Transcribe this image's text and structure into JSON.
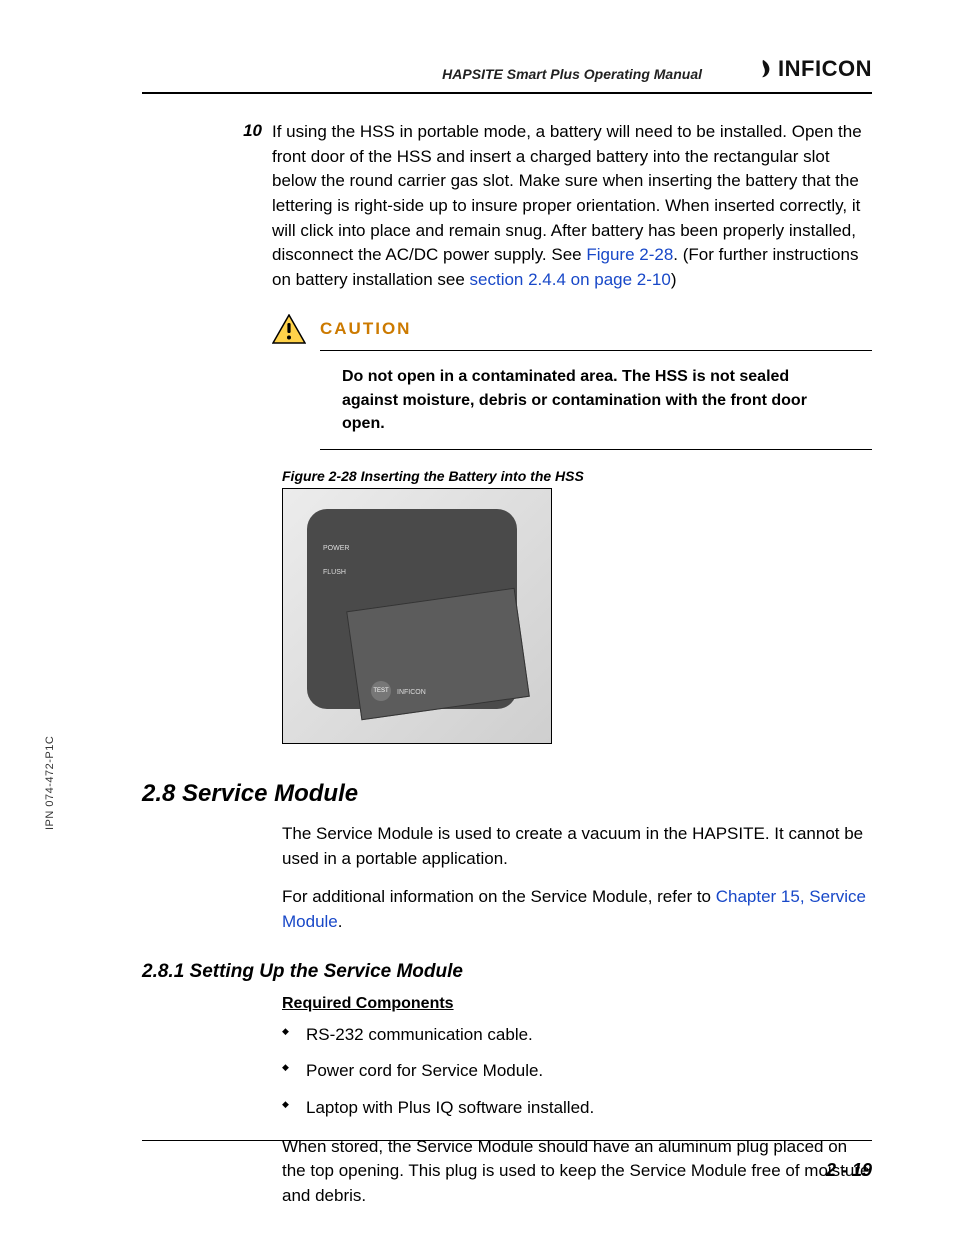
{
  "header": {
    "doc_title": "HAPSITE Smart Plus Operating Manual",
    "brand": "INFICON"
  },
  "step": {
    "number": "10",
    "text_pre": "If using the HSS in portable mode, a battery will need to be installed. Open the front door of the HSS and insert a charged battery into the rectangular slot below the round carrier gas slot. Make sure when inserting the battery that the lettering is right-side up to insure proper orientation. When inserted correctly, it will click into place and remain snug. After battery has been properly installed, disconnect the AC/DC power supply. See ",
    "link1": "Figure 2-28",
    "text_mid": ". (For further instructions on battery installation see ",
    "link2": "section 2.4.4 on page 2-10",
    "text_post": ")"
  },
  "caution": {
    "title": "CAUTION",
    "body": "Do not open in a contaminated area. The HSS is not sealed against moisture, debris or contamination with the front door open."
  },
  "figure": {
    "caption": "Figure 2-28  Inserting the Battery into the HSS",
    "label_power": "POWER",
    "label_flush": "FLUSH",
    "badge": "TEST",
    "brand_small": "INFICON"
  },
  "section28": {
    "heading": "2.8  Service Module",
    "p1": "The Service Module is used to create a vacuum in the HAPSITE. It cannot be used in a portable application.",
    "p2_pre": "For additional information on the Service Module, refer to ",
    "p2_link": "Chapter 15, Service Module",
    "p2_post": "."
  },
  "section281": {
    "heading": "2.8.1  Setting Up the Service Module",
    "subhead": "Required Components",
    "items": [
      "RS-232 communication cable.",
      "Power cord for Service Module.",
      "Laptop with Plus IQ software installed."
    ],
    "p_after": "When stored, the Service Module should have an aluminum plug placed on the top opening. This plug is used to keep the Service Module free of moisture and debris."
  },
  "side_text": "IPN 074-472-P1C",
  "page_number": "2 - 19"
}
